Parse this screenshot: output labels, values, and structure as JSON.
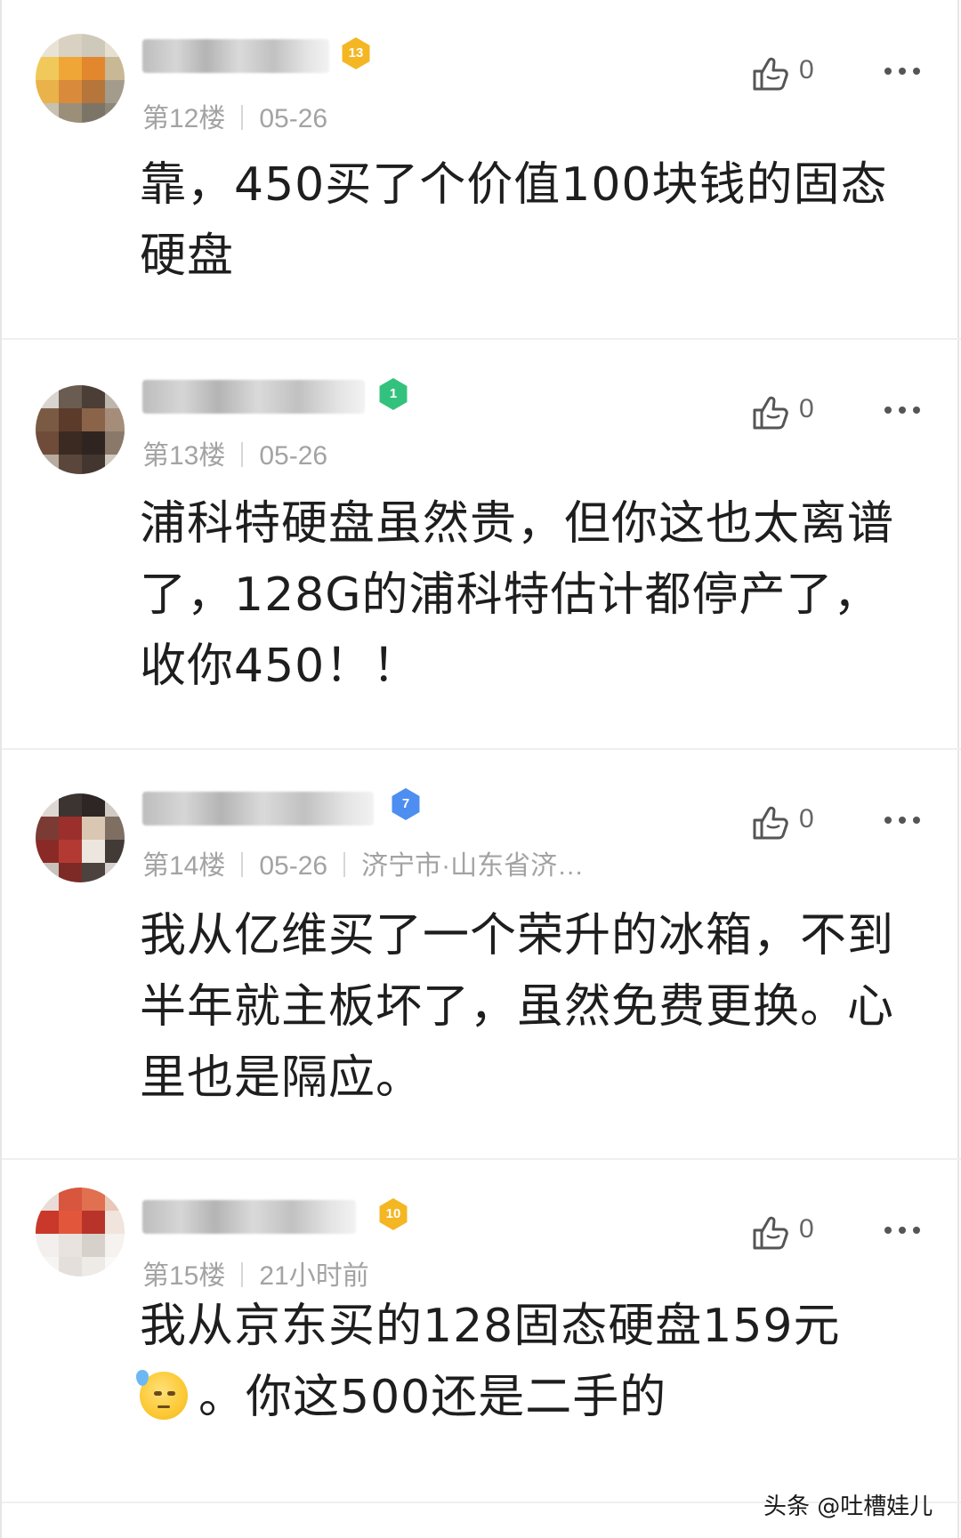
{
  "comments": [
    {
      "floor": "第12楼",
      "date": "05-26",
      "location": "",
      "badge_level": "13",
      "badge_color": "#f4b623",
      "like_count": "0",
      "body": "靠，450买了个价值100块钱的固态硬盘"
    },
    {
      "floor": "第13楼",
      "date": "05-26",
      "location": "",
      "badge_level": "1",
      "badge_color": "#33c27e",
      "like_count": "0",
      "body": "浦科特硬盘虽然贵，但你这也太离谱了，128G的浦科特估计都停产了，收你450！！"
    },
    {
      "floor": "第14楼",
      "date": "05-26",
      "location": "济宁市·山东省济…",
      "badge_level": "7",
      "badge_color": "#4d8ef0",
      "like_count": "0",
      "body": "我从亿维买了一个荣升的冰箱，不到半年就主板坏了，虽然免费更换。心里也是隔应。"
    },
    {
      "floor": "第15楼",
      "date": "21小时前",
      "location": "",
      "badge_level": "10",
      "badge_color": "#f4b623",
      "like_count": "0",
      "body_before_emoji": "我从京东买的128固态硬盘159元",
      "emoji": "sweat-face-emoji",
      "body_after_emoji": "。你这500还是二手的"
    }
  ],
  "watermark": "头条 @吐槽娃儿"
}
